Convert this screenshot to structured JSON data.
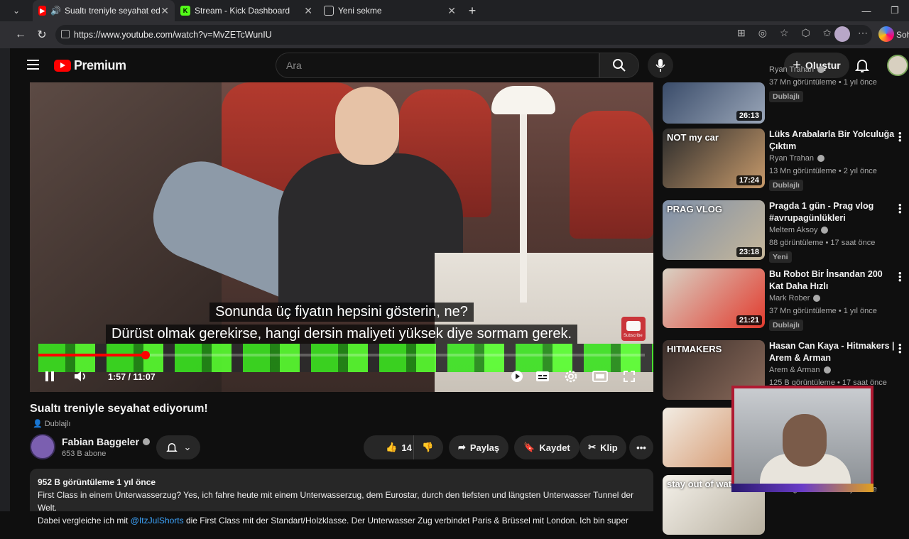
{
  "browser": {
    "tabs": [
      {
        "title": "Sualtı treniyle seyahat ediyorum",
        "favicon": "youtube-icon",
        "active": true
      },
      {
        "title": "Stream - Kick Dashboard",
        "favicon": "kick-icon",
        "active": false
      },
      {
        "title": "Yeni sekme",
        "favicon": "newtab-icon",
        "active": false
      }
    ],
    "url": "https://www.youtube.com/watch?v=MvZETcWunIU",
    "copilot_label": "Soh"
  },
  "header": {
    "logo_text": "Premium",
    "search_placeholder": "Ara",
    "create_label": "Oluştur"
  },
  "player": {
    "subtitle_line1": "Sonunda üç fiyatın hepsini gösterin, ne?",
    "subtitle_line2": "Dürüst olmak gerekirse, hangi dersin maliyeti yüksek diye sormam gerek.",
    "time": "1:57 / 11:07",
    "progress_fraction": 0.177,
    "subscribe_badge": "Subscribe"
  },
  "video": {
    "title": "Sualtı treniyle seyahat ediyorum!",
    "dub_label": "Dublajlı",
    "channel": "Fabian Baggeler",
    "subscribers": "653 B abone",
    "likes": "14 B",
    "share_label": "Paylaş",
    "save_label": "Kaydet",
    "clip_label": "Klip",
    "desc_meta": "952 B görüntüleme  1 yıl önce",
    "desc_line1": "First Class in einem Unterwasserzug? Yes, ich fahre heute mit einem Unterwasserzug, dem Eurostar, durch den tiefsten und längsten Unterwasser Tunnel der Welt.",
    "desc_line2_pre": "Dabei vergleiche ich mit ",
    "desc_link": "@ItzJulShorts",
    "desc_line2_post": " die First Class mit der Standart/Holzklasse. Der Unterwasser Zug verbindet Paris & Brüssel mit London. Ich bin super"
  },
  "sidebar": [
    {
      "title": "",
      "channel": "Ryan Trahan",
      "meta": "37 Mn görüntüleme • 1 yıl önce",
      "duration": "26:13",
      "badge": "Dublajlı"
    },
    {
      "title": "Lüks Arabalarla Bir Yolculuğa Çıktım",
      "channel": "Ryan Trahan",
      "meta": "13 Mn görüntüleme • 2 yıl önce",
      "duration": "17:24",
      "badge": "Dublajlı",
      "thumb_text": "NOT my car"
    },
    {
      "title": "Pragda 1 gün - Prag vlog #avrupagünlükleri",
      "channel": "Meltem Aksoy",
      "meta": "88 görüntüleme • 17 saat önce",
      "duration": "23:18",
      "badge": "Yeni",
      "thumb_text": "PRAG VLOG"
    },
    {
      "title": "Bu Robot Bir İnsandan 200 Kat Daha Hızlı",
      "channel": "Mark Rober",
      "meta": "37 Mn görüntüleme • 1 yıl önce",
      "duration": "21:21",
      "badge": "Dublajlı"
    },
    {
      "title": "Hasan Can Kaya - Hitmakers | Arem & Arman",
      "channel": "Arem & Arman",
      "meta": "125 B görüntüleme • 17 saat önce",
      "duration": "",
      "badge": "",
      "thumb_text": "HITMAKERS"
    },
    {
      "title": "",
      "channel": "",
      "meta": "",
      "duration": "",
      "badge": ""
    },
    {
      "title": "",
      "channel": "",
      "meta": "30 Mn görüntüleme • 2 yıl önce",
      "duration": "",
      "badge": "",
      "thumb_text": "stay out of water"
    }
  ]
}
